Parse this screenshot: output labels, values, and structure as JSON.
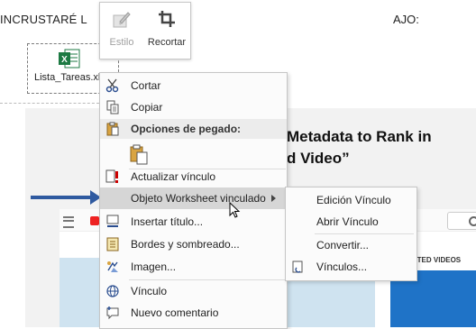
{
  "document": {
    "heading_text": "INCRUSTARÉ L",
    "heading_text_right": "AJO:",
    "embedded_file_label": "Lista_Tareas.xl"
  },
  "mini_toolbar": {
    "buttons": [
      {
        "label": "Estilo",
        "icon": "style-brush-icon",
        "enabled": false
      },
      {
        "label": "Recortar",
        "icon": "crop-icon",
        "enabled": true
      }
    ]
  },
  "context_menu": {
    "items": [
      {
        "label": "Cortar",
        "icon": "scissors-icon"
      },
      {
        "label": "Copiar",
        "icon": "copy-icon"
      },
      {
        "label": "Opciones de pegado:",
        "icon": "clipboard-icon",
        "is_header": true
      },
      {
        "label": "",
        "icon": "paste-picture-icon"
      },
      {
        "label": "Actualizar vínculo",
        "icon": "update-link-icon"
      },
      {
        "label": "Objeto Worksheet vinculado",
        "icon": "",
        "has_submenu": true,
        "highlighted": true
      },
      {
        "label": "Insertar título...",
        "icon": "insert-caption-icon"
      },
      {
        "label": "Bordes y sombreado...",
        "icon": "borders-icon"
      },
      {
        "label": "Imagen...",
        "icon": "format-picture-icon"
      },
      {
        "label": "Vínculo",
        "icon": "hyperlink-icon"
      },
      {
        "label": "Nuevo comentario",
        "icon": "new-comment-icon"
      }
    ]
  },
  "submenu": {
    "items": [
      {
        "label": "Edición  Vínculo"
      },
      {
        "label": "Abrir  Vínculo"
      },
      {
        "label": "Convertir..."
      },
      {
        "label": "Vínculos...",
        "icon": "links-icon"
      }
    ]
  },
  "background": {
    "headline_line1": "Metadata to Rank in",
    "headline_line2": "d Video”",
    "side_label": "ESTED VIDEOS"
  },
  "colors": {
    "arrow": "#2f5aa0",
    "excel_green": "#1d7a43",
    "highlight": "#d6d6d6",
    "blue_block": "#1f73c7"
  }
}
